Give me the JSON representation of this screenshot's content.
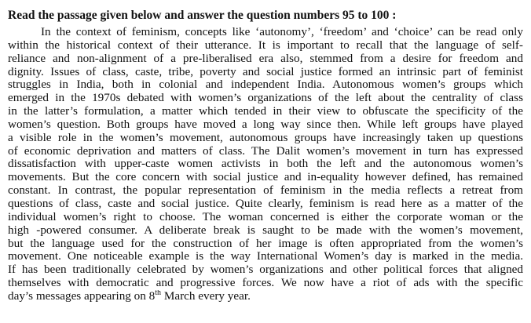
{
  "heading": "Read the passage given below and answer the question numbers 95 to 100 :",
  "passage_lines": [
    "In the context of feminism, concepts like ‘autonomy’, ‘freedom’ and ‘choice’ can be read only",
    "within the historical context of their utterance. It is important to recall that the language of self-",
    "reliance and non-alignment of a pre-liberalised era also, stemmed from a desire for freedom and",
    "dignity. Issues of class, caste, tribe, poverty and social justice formed an intrinsic part of feminist",
    "struggles in India, both in colonial and independent India. Autonomous women’s groups which",
    "emerged in the 1970s debated with women’s organizations of the left about the centrality of class",
    "in the latter’s formulation, a matter which tended in their view to obfuscate the specificity of the",
    "women’s question. Both groups have moved a long way since then. While left groups have played",
    "a visible role in the women’s movement, autonomous groups have increasingly taken up questions",
    "of economic deprivation and matters of class. The Dalit women’s movement in turn has expressed",
    "dissatisfaction with upper-caste women activists in both the left and the autonomous women’s",
    "movements. But the core concern with social justice and in-equality however defined, has remained",
    "constant. In contrast, the popular representation of feminism in the media reflects a retreat from",
    "questions of class, caste and social justice. Quite clearly, feminism is read here as a matter of the",
    "individual women’s right to choose. The woman concerned is either the corporate woman or the",
    "high -powered consumer. A deliberate break is saught to be made with the women’s movement,",
    "but the language used for the construction of her image is often appropriated from the women’s",
    "movement. One noticeable example is the way International Women’s day is marked in the media.",
    "If has been traditionally celebrated by women’s organizations and other political forces that aligned",
    "themselves with democratic and progressive forces. We now have a riot of ads with the specific"
  ],
  "last_line": {
    "before": "day’s messages appearing on 8",
    "superscript": "th",
    "after": " March every year."
  }
}
